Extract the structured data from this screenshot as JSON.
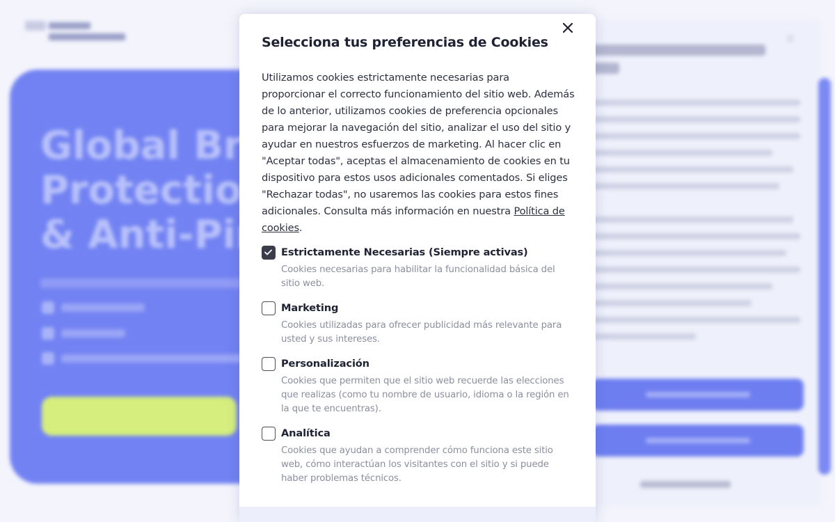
{
  "background": {
    "hero_title": "Global Bran\nProtection\n& Anti-Pirac"
  },
  "modal": {
    "title": "Selecciona tus preferencias de Cookies",
    "intro_text": "Utilizamos cookies estrictamente necesarias para proporcionar el correcto funcionamiento del sitio web. Además de lo anterior, utilizamos cookies de preferencia opcionales para mejorar la navegación del sitio, analizar el uso del sitio y ayudar en nuestros esfuerzos de marketing. Al hacer clic en \"Aceptar todas\", aceptas el almacenamiento de cookies en tu dispositivo para estos usos adicionales comentados. Si eliges \"Rechazar todas\", no usaremos las cookies para estos fines adicionales. Consulta más información en nuestra ",
    "policy_link": "Política de cookies",
    "intro_end": ".",
    "close_icon": "close-icon",
    "options": [
      {
        "title": "Estrictamente Necesarias (Siempre activas)",
        "description": "Cookies necesarias para habilitar la funcionalidad básica del sitio web.",
        "checked": true
      },
      {
        "title": "Marketing",
        "description": "Cookies utilizadas para ofrecer publicidad más relevante para usted y sus intereses.",
        "checked": false
      },
      {
        "title": "Personalización",
        "description": "Cookies que permiten que el sitio web recuerde las elecciones que realizas (como tu nombre de usuario, idioma o la región en la que te encuentras).",
        "checked": false
      },
      {
        "title": "Analítica",
        "description": "Cookies que ayudan a comprender cómo funciona este sitio web, cómo interactúan los visitantes con el sitio y si puede haber problemas técnicos.",
        "checked": false
      }
    ]
  },
  "colors": {
    "hero_bg": "#7282f2",
    "cta_bg": "#d5ee7e",
    "checkbox_checked": "#3b3e4a",
    "desc_text": "#8b8e9e"
  }
}
